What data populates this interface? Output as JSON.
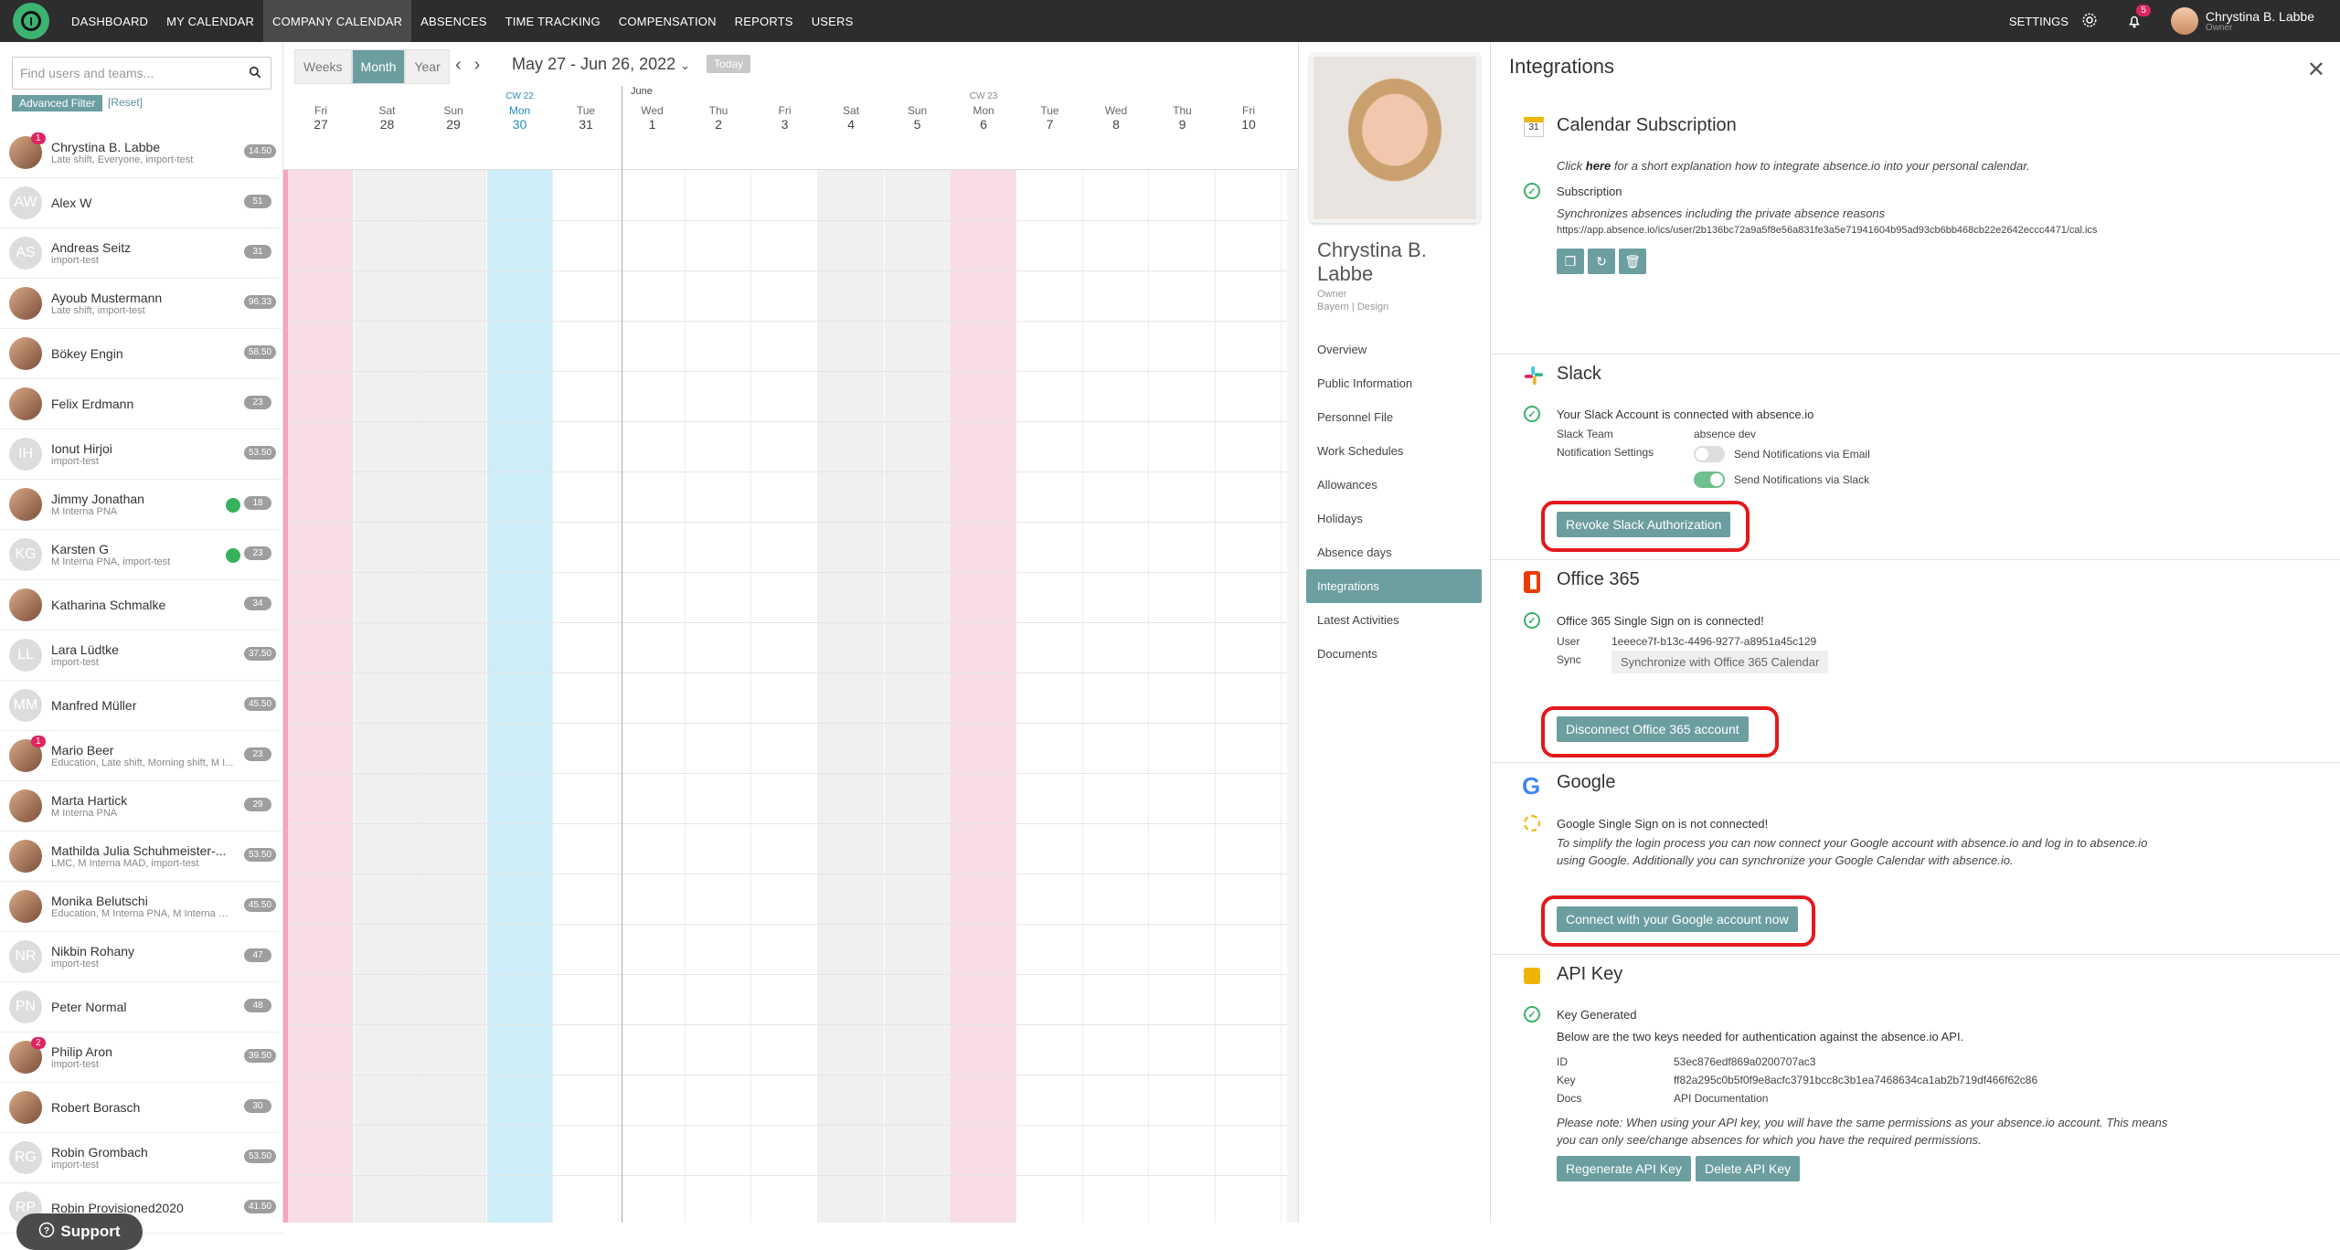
{
  "nav": {
    "items": [
      "DASHBOARD",
      "MY CALENDAR",
      "COMPANY CALENDAR",
      "ABSENCES",
      "TIME TRACKING",
      "COMPENSATION",
      "REPORTS",
      "USERS"
    ],
    "active": 2,
    "settings": "SETTINGS",
    "notif_count": "5",
    "user_name": "Chrystina B. Labbe",
    "user_role": "Owner"
  },
  "left": {
    "search_placeholder": "Find users and teams...",
    "adv_filter": "Advanced Filter",
    "reset": "[Reset]",
    "support": "Support",
    "users": [
      {
        "initials": "",
        "name": "Chrystina B. Labbe",
        "sub": "Late shift, Everyone, import-test",
        "count": "14.50",
        "badge": "1",
        "pic": true,
        "dot": false
      },
      {
        "initials": "AW",
        "name": "Alex W",
        "sub": "",
        "count": "51",
        "badge": "",
        "pic": false,
        "dot": false
      },
      {
        "initials": "AS",
        "name": "Andreas Seitz",
        "sub": "import-test",
        "count": "31",
        "badge": "",
        "pic": false,
        "dot": false
      },
      {
        "initials": "",
        "name": "Ayoub Mustermann",
        "sub": "Late shift, import-test",
        "count": "96.33",
        "badge": "",
        "pic": true,
        "dot": false
      },
      {
        "initials": "",
        "name": "Bökey Engin",
        "sub": "",
        "count": "58.50",
        "badge": "",
        "pic": true,
        "dot": false
      },
      {
        "initials": "",
        "name": "Felix Erdmann",
        "sub": "",
        "count": "23",
        "badge": "",
        "pic": true,
        "dot": false
      },
      {
        "initials": "IH",
        "name": "Ionut Hirjoi",
        "sub": "import-test",
        "count": "53.50",
        "badge": "",
        "pic": false,
        "dot": false
      },
      {
        "initials": "",
        "name": "Jimmy Jonathan",
        "sub": "M Interna PNA",
        "count": "18",
        "badge": "",
        "pic": true,
        "dot": true
      },
      {
        "initials": "KG",
        "name": "Karsten G",
        "sub": "M Interna PNA, import-test",
        "count": "23",
        "badge": "",
        "pic": false,
        "dot": true
      },
      {
        "initials": "",
        "name": "Katharina Schmalke",
        "sub": "",
        "count": "34",
        "badge": "",
        "pic": true,
        "dot": false
      },
      {
        "initials": "LL",
        "name": "Lara Lüdtke",
        "sub": "import-test",
        "count": "37.50",
        "badge": "",
        "pic": false,
        "dot": false
      },
      {
        "initials": "MM",
        "name": "Manfred Müller",
        "sub": "",
        "count": "45.50",
        "badge": "",
        "pic": false,
        "dot": false
      },
      {
        "initials": "",
        "name": "Mario Beer",
        "sub": "Education, Late shift, Morning shift, M I...",
        "count": "23",
        "badge": "1",
        "pic": true,
        "dot": false
      },
      {
        "initials": "",
        "name": "Marta Hartick",
        "sub": "M Interna PNA",
        "count": "29",
        "badge": "",
        "pic": true,
        "dot": false
      },
      {
        "initials": "",
        "name": "Mathilda Julia Schuhmeister-...",
        "sub": "LMC, M Interna MAD, import-test",
        "count": "53.50",
        "badge": "",
        "pic": true,
        "dot": false
      },
      {
        "initials": "",
        "name": "Monika Belutschi",
        "sub": "Education, M Interna PNA, M Interna M...",
        "count": "45.50",
        "badge": "",
        "pic": true,
        "dot": false
      },
      {
        "initials": "NR",
        "name": "Nikbin Rohany",
        "sub": "import-test",
        "count": "47",
        "badge": "",
        "pic": false,
        "dot": false
      },
      {
        "initials": "PN",
        "name": "Peter Normal",
        "sub": "",
        "count": "48",
        "badge": "",
        "pic": false,
        "dot": false
      },
      {
        "initials": "",
        "name": "Philip Aron",
        "sub": "import-test",
        "count": "39.50",
        "badge": "2",
        "pic": true,
        "dot": false
      },
      {
        "initials": "",
        "name": "Robert Borasch",
        "sub": "",
        "count": "30",
        "badge": "",
        "pic": true,
        "dot": false
      },
      {
        "initials": "RG",
        "name": "Robin Grombach",
        "sub": "import-test",
        "count": "53.50",
        "badge": "",
        "pic": false,
        "dot": false
      },
      {
        "initials": "RP",
        "name": "Robin Provisioned2020",
        "sub": "",
        "count": "41.50",
        "badge": "",
        "pic": false,
        "dot": false
      }
    ]
  },
  "calendar": {
    "views": [
      "Weeks",
      "Month",
      "Year"
    ],
    "active_view": 1,
    "range": "May 27 - Jun 26, 2022",
    "today": "Today",
    "month_label": "June",
    "days": [
      {
        "cw": "",
        "dn": "Fri",
        "dd": "27",
        "type": "hol"
      },
      {
        "cw": "",
        "dn": "Sat",
        "dd": "28",
        "type": "we"
      },
      {
        "cw": "",
        "dn": "Sun",
        "dd": "29",
        "type": "we"
      },
      {
        "cw": "CW 22",
        "dn": "Mon",
        "dd": "30",
        "type": "td"
      },
      {
        "cw": "",
        "dn": "Tue",
        "dd": "31",
        "type": ""
      },
      {
        "cw": "",
        "dn": "Wed",
        "dd": "1",
        "type": ""
      },
      {
        "cw": "",
        "dn": "Thu",
        "dd": "2",
        "type": ""
      },
      {
        "cw": "",
        "dn": "Fri",
        "dd": "3",
        "type": ""
      },
      {
        "cw": "",
        "dn": "Sat",
        "dd": "4",
        "type": "we"
      },
      {
        "cw": "",
        "dn": "Sun",
        "dd": "5",
        "type": "we"
      },
      {
        "cw": "CW 23",
        "dn": "Mon",
        "dd": "6",
        "type": "hol"
      },
      {
        "cw": "",
        "dn": "Tue",
        "dd": "7",
        "type": ""
      },
      {
        "cw": "",
        "dn": "Wed",
        "dd": "8",
        "type": ""
      },
      {
        "cw": "",
        "dn": "Thu",
        "dd": "9",
        "type": ""
      },
      {
        "cw": "",
        "dn": "Fri",
        "dd": "10",
        "type": ""
      }
    ]
  },
  "profile": {
    "name": "Chrystina B. Labbe",
    "role": "Owner",
    "location": "Bayern | Design",
    "menu": [
      "Overview",
      "Public Information",
      "Personnel File",
      "Work Schedules",
      "Allowances",
      "Holidays",
      "Absence days",
      "Integrations",
      "Latest Activities",
      "Documents"
    ],
    "active": 7
  },
  "integrations": {
    "title": "Integrations",
    "calendar": {
      "title": "Calendar Subscription",
      "click": "Click ",
      "here": "here",
      "explain": " for a short explanation how to integrate absence.io into your personal calendar.",
      "sub_label": "Subscription",
      "sync_note": "Synchronizes absences including the private absence reasons",
      "url": "https://app.absence.io/ics/user/2b136bc72a9a5f8e56a831fe3a5e71941604b95ad93cb6bb468cb22e2642eccc4471/cal.ics"
    },
    "slack": {
      "title": "Slack",
      "connected": "Your Slack Account is connected with absence.io",
      "team_label": "Slack Team",
      "team_value": "absence dev",
      "notif_label": "Notification Settings",
      "email_opt": "Send Notifications via Email",
      "slack_opt": "Send Notifications via Slack",
      "revoke": "Revoke Slack Authorization"
    },
    "office": {
      "title": "Office 365",
      "connected": "Office 365 Single Sign on is connected!",
      "user_label": "User",
      "user_value": "1eeece7f-b13c-4496-9277-a8951a45c129",
      "sync_label": "Sync",
      "sync_value": "Synchronize with Office 365 Calendar",
      "disconnect": "Disconnect Office 365 account"
    },
    "google": {
      "title": "Google",
      "status": "Google Single Sign on is not connected!",
      "desc1": "To simplify the login process you can now connect your Google account with absence.io and log in to absence.io",
      "desc2": "using Google. Additionally you can synchronize your Google Calendar with absence.io.",
      "connect": "Connect with your Google account now"
    },
    "api": {
      "title": "API Key",
      "status": "Key Generated",
      "below": "Below are the two keys needed for authentication against the absence.io API.",
      "id_label": "ID",
      "id_value": "53ec876edf869a0200707ac3",
      "key_label": "Key",
      "key_value": "ff82a295c0b5f0f9e8acfc3791bcc8c3b1ea7468634ca1ab2b719df466f62c86",
      "docs_label": "Docs",
      "docs_value": "API Documentation",
      "note1": "Please note: When using your API key, you will have the same permissions as your absence.io account. This means",
      "note2": "you can only see/change absences for which you have the required permissions.",
      "regen": "Regenerate API Key",
      "delete": "Delete API Key"
    }
  }
}
